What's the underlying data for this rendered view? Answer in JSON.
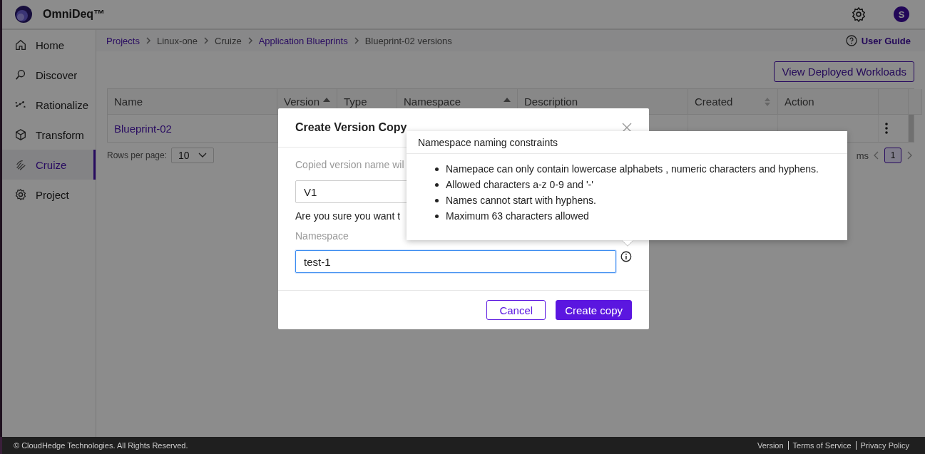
{
  "app": {
    "name": "OmniDeq™",
    "avatar": "S"
  },
  "sidebar": {
    "items": [
      {
        "label": "Home",
        "selected": false
      },
      {
        "label": "Discover",
        "selected": false
      },
      {
        "label": "Rationalize",
        "selected": false
      },
      {
        "label": "Transform",
        "selected": false
      },
      {
        "label": "Cruize",
        "selected": true
      },
      {
        "label": "Project",
        "selected": false
      }
    ]
  },
  "breadcrumbs": [
    {
      "label": "Projects",
      "link": true
    },
    {
      "label": "Linux-one",
      "link": false
    },
    {
      "label": "Cruize",
      "link": false
    },
    {
      "label": "Application Blueprints",
      "link": true
    },
    {
      "label": "Blueprint-02 versions",
      "link": false
    }
  ],
  "user_guide": "User Guide",
  "view_button": "View Deployed Workloads",
  "table": {
    "columns": [
      {
        "label": "Name"
      },
      {
        "label": "Version",
        "sorted": true
      },
      {
        "label": "Type"
      },
      {
        "label": "Namespace",
        "sorted": true
      },
      {
        "label": "Description"
      },
      {
        "label": "Created",
        "sorted": false
      },
      {
        "label": "Action"
      }
    ],
    "rows": [
      {
        "name": "Blueprint-02"
      }
    ]
  },
  "pagination": {
    "rows_per_page_label": "Rows per page:",
    "rows_per_page": "10",
    "range": "ms",
    "pages": [
      {
        "label": "1",
        "selected": true
      }
    ]
  },
  "modal": {
    "title": "Create Version Copy",
    "hint": "Copied version name wil",
    "version_value": "V1",
    "question": "Are you sure you want t",
    "namespace_label": "Namespace",
    "namespace_value": "test-1",
    "buttons": [
      {
        "label": "Cancel",
        "kind": "secondary"
      },
      {
        "label": "Create copy",
        "kind": "primary"
      }
    ]
  },
  "tooltip": {
    "title": "Namespace naming constraints",
    "items": [
      "Namepace can only contain lowercase alphabets , numeric characters and hyphens.",
      "Allowed characters a-z 0-9 and '-'",
      "Names cannot start with hyphens.",
      "Maximum 63 characters allowed"
    ]
  },
  "footer": {
    "copyright": "© CloudHedge Technologies. All Rights Reserved.",
    "links": [
      "Version",
      "Terms of Service",
      "Privacy Policy"
    ]
  }
}
